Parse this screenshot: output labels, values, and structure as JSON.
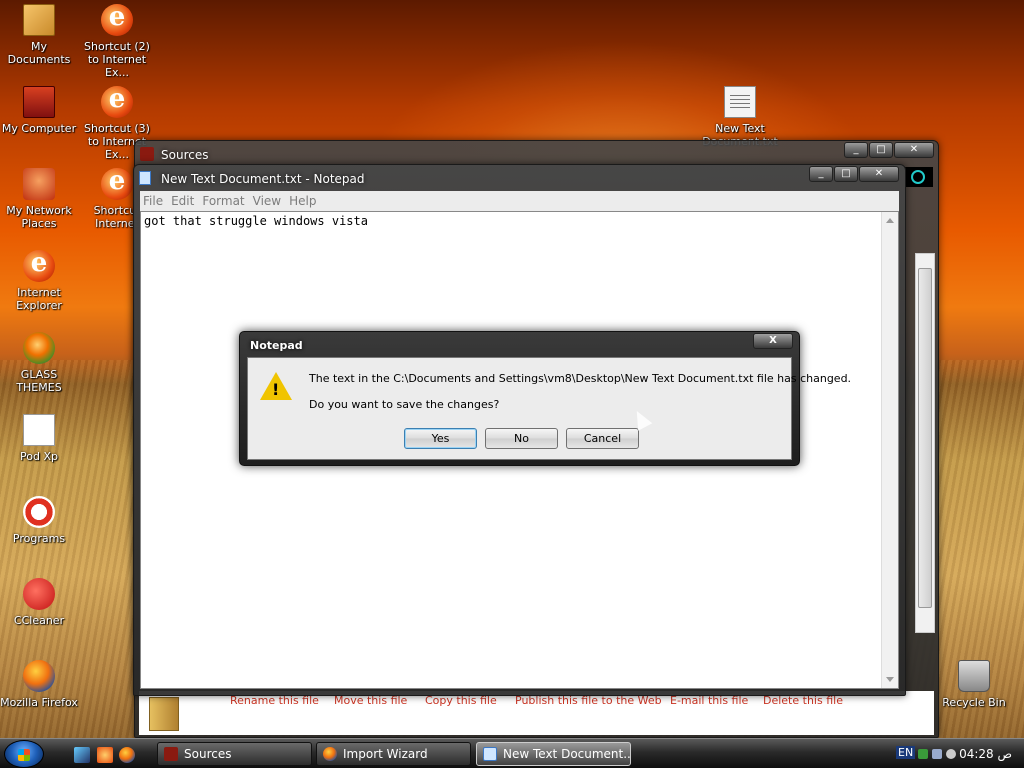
{
  "desktop": {
    "icons_left": [
      {
        "label": "My Documents",
        "icon": "folder-documents-icon"
      },
      {
        "label": "My Computer",
        "icon": "computer-icon"
      },
      {
        "label": "My Network Places",
        "icon": "network-places-icon"
      },
      {
        "label": "Internet Explorer",
        "icon": "internet-explorer-icon"
      },
      {
        "label": "GLASS THEMES",
        "icon": "glass-themes-icon"
      },
      {
        "label": "Pod Xp",
        "icon": "pod-xp-icon"
      },
      {
        "label": "Programs",
        "icon": "programs-icon"
      },
      {
        "label": "CCleaner",
        "icon": "ccleaner-icon"
      },
      {
        "label": "Mozilla Firefox",
        "icon": "firefox-icon"
      }
    ],
    "icons_col2": [
      {
        "label": "Shortcut (2) to Internet Ex...",
        "icon": "internet-explorer-icon"
      },
      {
        "label": "Shortcut (3) to Internet Ex...",
        "icon": "internet-explorer-icon"
      },
      {
        "label": "Shortcut Internet",
        "icon": "internet-explorer-icon"
      }
    ],
    "new_text_doc": {
      "label": "New Text Document.txt",
      "icon": "text-file-icon"
    },
    "recycle_bin": {
      "label": "Recycle Bin",
      "icon": "recycle-bin-icon"
    }
  },
  "sources_window": {
    "title": "Sources",
    "tasks": [
      "Rename this file",
      "Move this file",
      "Copy this file",
      "Publish this file to the Web",
      "E-mail this file",
      "Delete this file"
    ]
  },
  "notepad": {
    "title": "New Text Document.txt - Notepad",
    "menu": [
      "File",
      "Edit",
      "Format",
      "View",
      "Help"
    ],
    "content": "got that struggle windows vista"
  },
  "dialog": {
    "title": "Notepad",
    "close_label": "X",
    "message": "The text in the C:\\Documents and Settings\\vm8\\Desktop\\New Text Document.txt file has changed.",
    "question": "Do you want to save the changes?",
    "buttons": {
      "yes": "Yes",
      "no": "No",
      "cancel": "Cancel"
    },
    "icon": "warning-icon"
  },
  "taskbar": {
    "tasks": [
      {
        "label": "Sources",
        "active": false
      },
      {
        "label": "Import Wizard",
        "active": false
      },
      {
        "label": "New Text Document....",
        "active": true
      }
    ],
    "language": "EN",
    "clock": "04:28 ص"
  },
  "colors": {
    "accent": "#3c7fb1",
    "warning": "#f0c400",
    "desktop_sky": "#e85a00"
  }
}
